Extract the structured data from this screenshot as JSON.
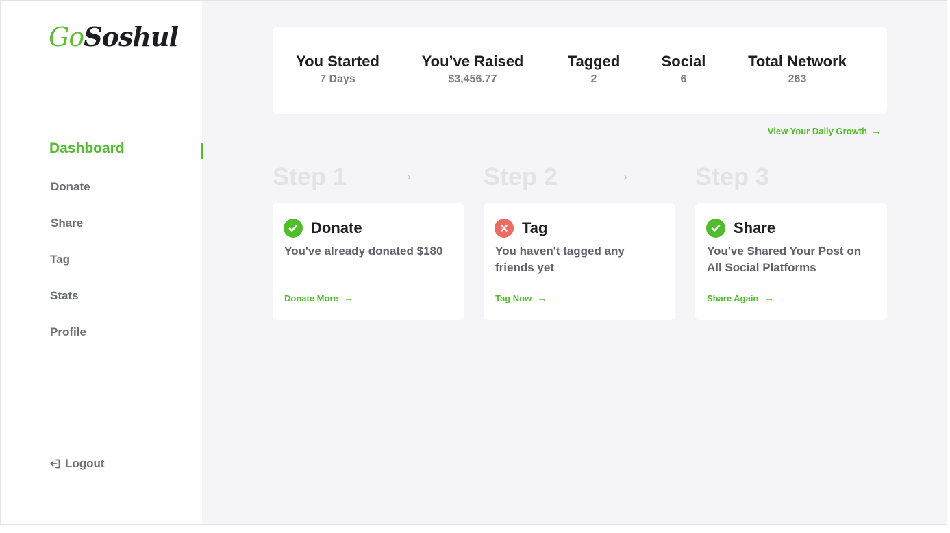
{
  "brand": {
    "go": "Go",
    "name": "Soshul"
  },
  "sidebar": {
    "items": [
      {
        "label": "Dashboard",
        "active": true
      },
      {
        "label": "Donate",
        "active": false
      },
      {
        "label": "Share",
        "active": false
      },
      {
        "label": "Tag",
        "active": false
      },
      {
        "label": "Stats",
        "active": false
      },
      {
        "label": "Profile",
        "active": false
      }
    ],
    "logout_label": "Logout",
    "logout_icon": "logout-icon"
  },
  "stats": [
    {
      "label": "You Started",
      "value": "7 Days"
    },
    {
      "label": "You’ve Raised",
      "value": "$3,456.77"
    },
    {
      "label": "Tagged",
      "value": "2"
    },
    {
      "label": "Social",
      "value": "6"
    },
    {
      "label": "Total Network",
      "value": "263"
    }
  ],
  "growth_link": {
    "label": "View Your Daily Growth",
    "icon": "arrow-right-icon"
  },
  "steps": [
    {
      "step_label": "Step 1",
      "title": "Donate",
      "status": "complete",
      "status_icon": "check-circle-icon",
      "text": "You've already donated $180",
      "link": "Donate More"
    },
    {
      "step_label": "Step 2",
      "title": "Tag",
      "status": "incomplete",
      "status_icon": "x-circle-icon",
      "text": "You haven't tagged any friends yet",
      "link": "Tag Now"
    },
    {
      "step_label": "Step 3",
      "title": "Share",
      "status": "complete",
      "status_icon": "check-circle-icon",
      "text": "You've Shared Your Post on All Social Platforms",
      "link": "Share Again"
    }
  ],
  "colors": {
    "accent": "#4fbe2a",
    "error": "#ef6b60",
    "background": "#f5f5f7",
    "text_dark": "#1f1f24",
    "text_muted": "#6d6f78"
  }
}
